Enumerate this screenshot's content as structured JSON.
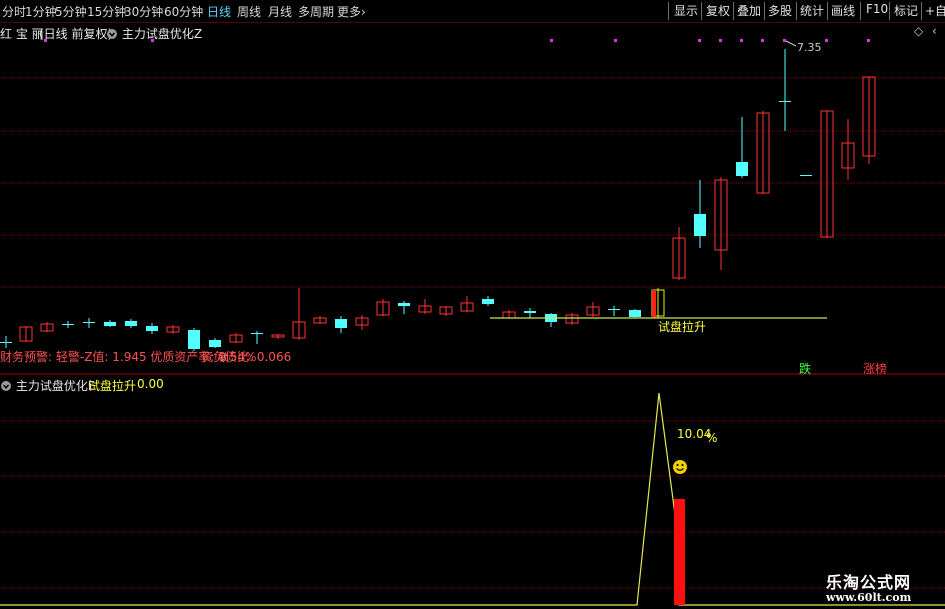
{
  "toolbar": {
    "periods": [
      "分时",
      "1分钟",
      "5分钟",
      "15分钟",
      "30分钟",
      "60分钟",
      "日线",
      "周线",
      "月线",
      "多周期",
      "更多"
    ],
    "active_period": "日线",
    "more_arrow": "›",
    "right_buttons": [
      "显示",
      "复权",
      "叠加",
      "多股",
      "统计",
      "画线",
      "F10",
      "标记",
      "+自选"
    ]
  },
  "main_chart": {
    "stock_name": "红 宝 丽",
    "mode": "(日线 前复权)",
    "indicator": "主力试盘优化Z",
    "top_price_label": "7.35",
    "signal_text": "试盘拉升",
    "finance_line": "财务预警: 轻警-Z值: 1.945 优质资产率: 0.54%",
    "debt_line": "资负债比: 0.066",
    "lock_text": "锁",
    "drop_label": "跌",
    "limit_label": "涨榜",
    "diamond_icon": "diamond-icon",
    "collapse_icon": "chevron-left-icon"
  },
  "sub_chart": {
    "indicator": "主力试盘优化F",
    "signal_name": "试盘拉升",
    "signal_value": "0.00",
    "peak_label": "10.04",
    "percent_glyph": "%",
    "smiley_icon": "smiley-icon"
  },
  "watermark": {
    "title": "乐淘公式网",
    "url": "www.60lt.com"
  },
  "colors": {
    "up": "#ff3232",
    "down": "#54ffff",
    "grid": "#7a0000",
    "signal_line": "#c8e650",
    "indicator_line": "#e8e850",
    "signal_bar": "#ff1010",
    "marker": "#e030e0"
  }
}
